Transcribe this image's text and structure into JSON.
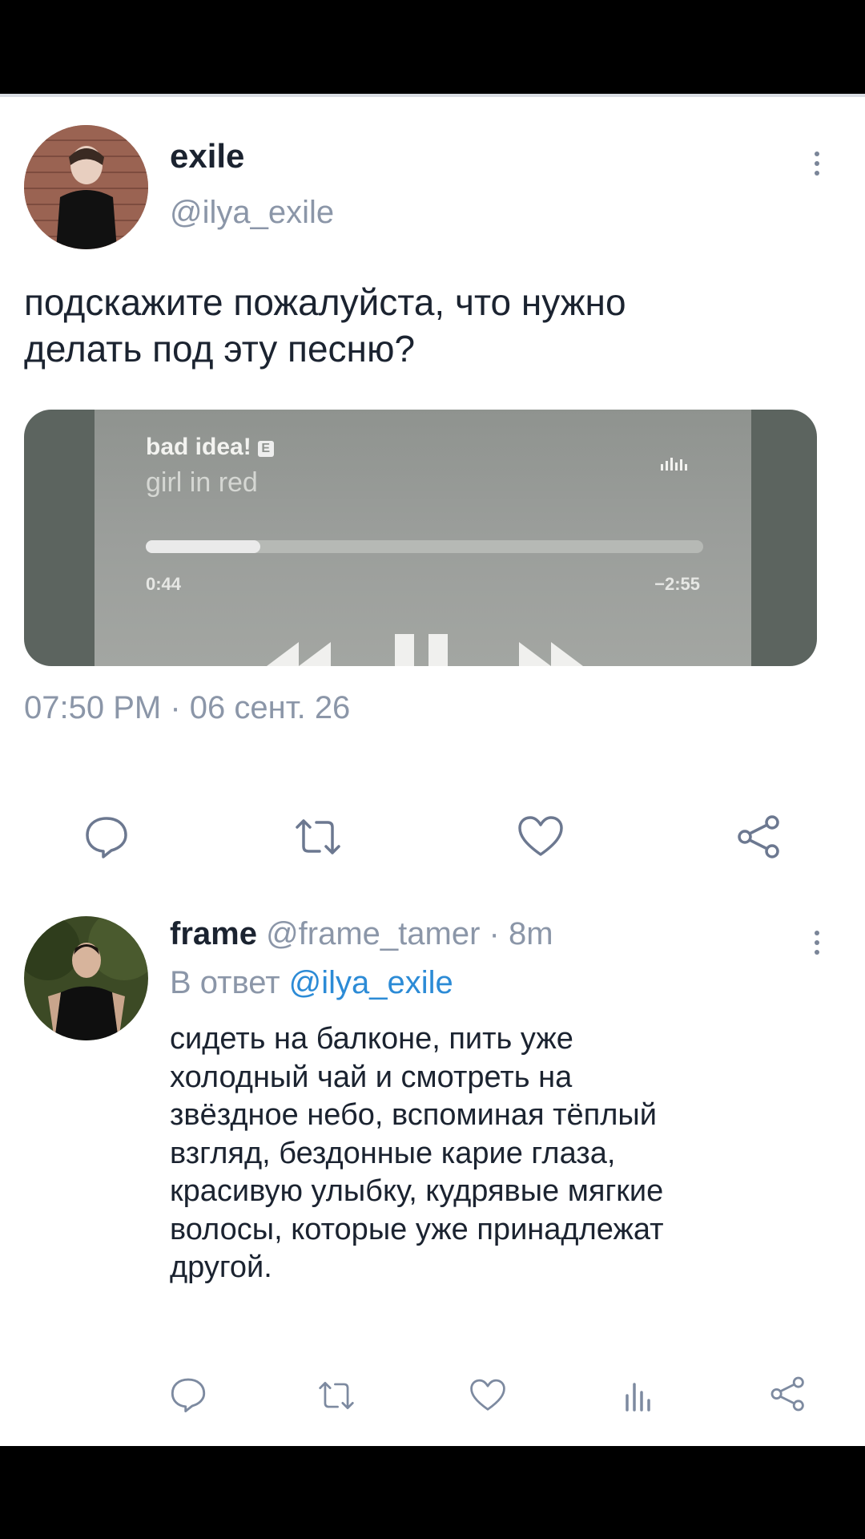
{
  "tweet": {
    "display_name": "exile",
    "handle": "@ilya_exile",
    "text_lines": [
      "подскажите пожалуйста, что нужно",
      "делать под эту песню?"
    ],
    "player": {
      "song": "bad idea!",
      "explicit_badge": "E",
      "artist": "girl in red",
      "elapsed": "0:44",
      "remaining": "−2:55",
      "progress": 0.206
    },
    "date": "07:50 PM · 06 сент. 26"
  },
  "reply": {
    "display_name": "frame",
    "handle": "@frame_tamer",
    "age": "· 8m",
    "reply_prefix": "В ответ",
    "reply_to": "@ilya_exile",
    "text_lines": [
      "сидеть на балконе, пить уже",
      "холодный чай и смотреть на",
      "звёздное небо, вспоминая тёплый",
      "взгляд, бездонные карие глаза,",
      "красивую улыбку, кудрявые мягкие",
      "волосы, которые уже принадлежат",
      "другой."
    ]
  },
  "icons": {
    "reply": "comment-icon",
    "retweet": "retweet-icon",
    "like": "heart-icon",
    "share": "share-icon",
    "stats": "stats-icon",
    "more": "more-vertical-icon"
  },
  "colors": {
    "text": "#1b2330",
    "muted": "#8b96a8",
    "link": "#2c8bd6"
  }
}
